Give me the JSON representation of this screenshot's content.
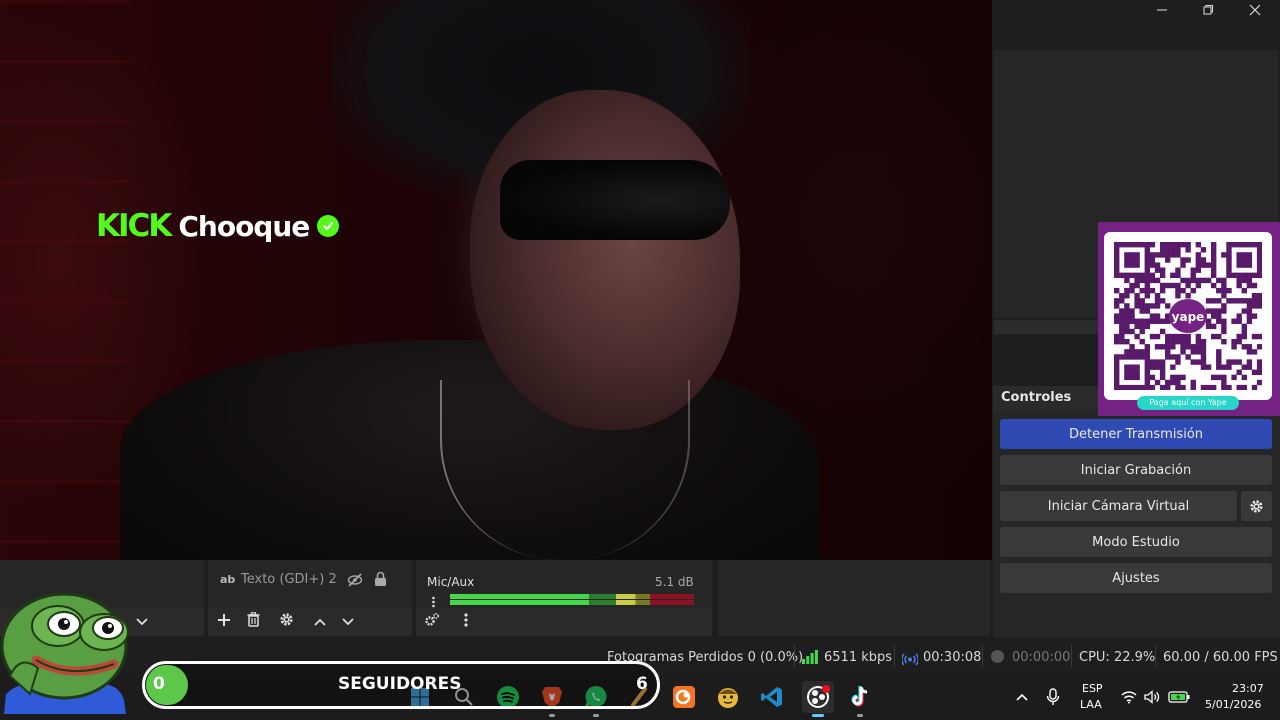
{
  "window": {
    "minimize_icon": "minimize-icon",
    "maximize_icon": "maximize-icon",
    "close_icon": "close-icon"
  },
  "overlay": {
    "platform": "KICK",
    "username": "Chooque",
    "verified_icon": "check-circle-icon",
    "accent_color": "#53fc18"
  },
  "qr": {
    "brand": "yape",
    "caption": "Paga aquí con Yape",
    "card_color": "#742384"
  },
  "controls": {
    "title": "Controles",
    "stream_button": "Detener Transmisión",
    "record_button": "Iniciar Grabación",
    "virtual_cam_button": "Iniciar Cámara Virtual",
    "studio_button": "Modo Estudio",
    "settings_button": "Ajustes",
    "active_color": "#2f4bb3"
  },
  "sources": {
    "item": {
      "type_icon": "ab",
      "label": "Texto (GDI+) 2",
      "visibility": "hidden",
      "locked": true
    }
  },
  "mixer": {
    "channel": {
      "name": "Mic/Aux",
      "level": "5.1 dB"
    }
  },
  "status": {
    "dropped_frames": "Fotogramas Perdidos 0 (0.0%)",
    "bitrate": "6511 kbps",
    "live_time": "00:30:08",
    "rec_time": "00:00:00",
    "cpu": "CPU: 22.9%",
    "fps": "60.00 / 60.00 FPS"
  },
  "followers": {
    "current": "0",
    "label": "SEGUIDORES",
    "goal": "6",
    "bar_color": "#5dc74a"
  },
  "taskbar": {
    "apps": [
      "windows-start",
      "search",
      "spotify",
      "brave",
      "whatsapp",
      "app",
      "crunchyroll",
      "emoji-app",
      "vscode",
      "obs",
      "tiktok"
    ],
    "lang_top": "ESP",
    "lang_bottom": "LAA",
    "time": "23:07",
    "date": "5/01/2026"
  }
}
